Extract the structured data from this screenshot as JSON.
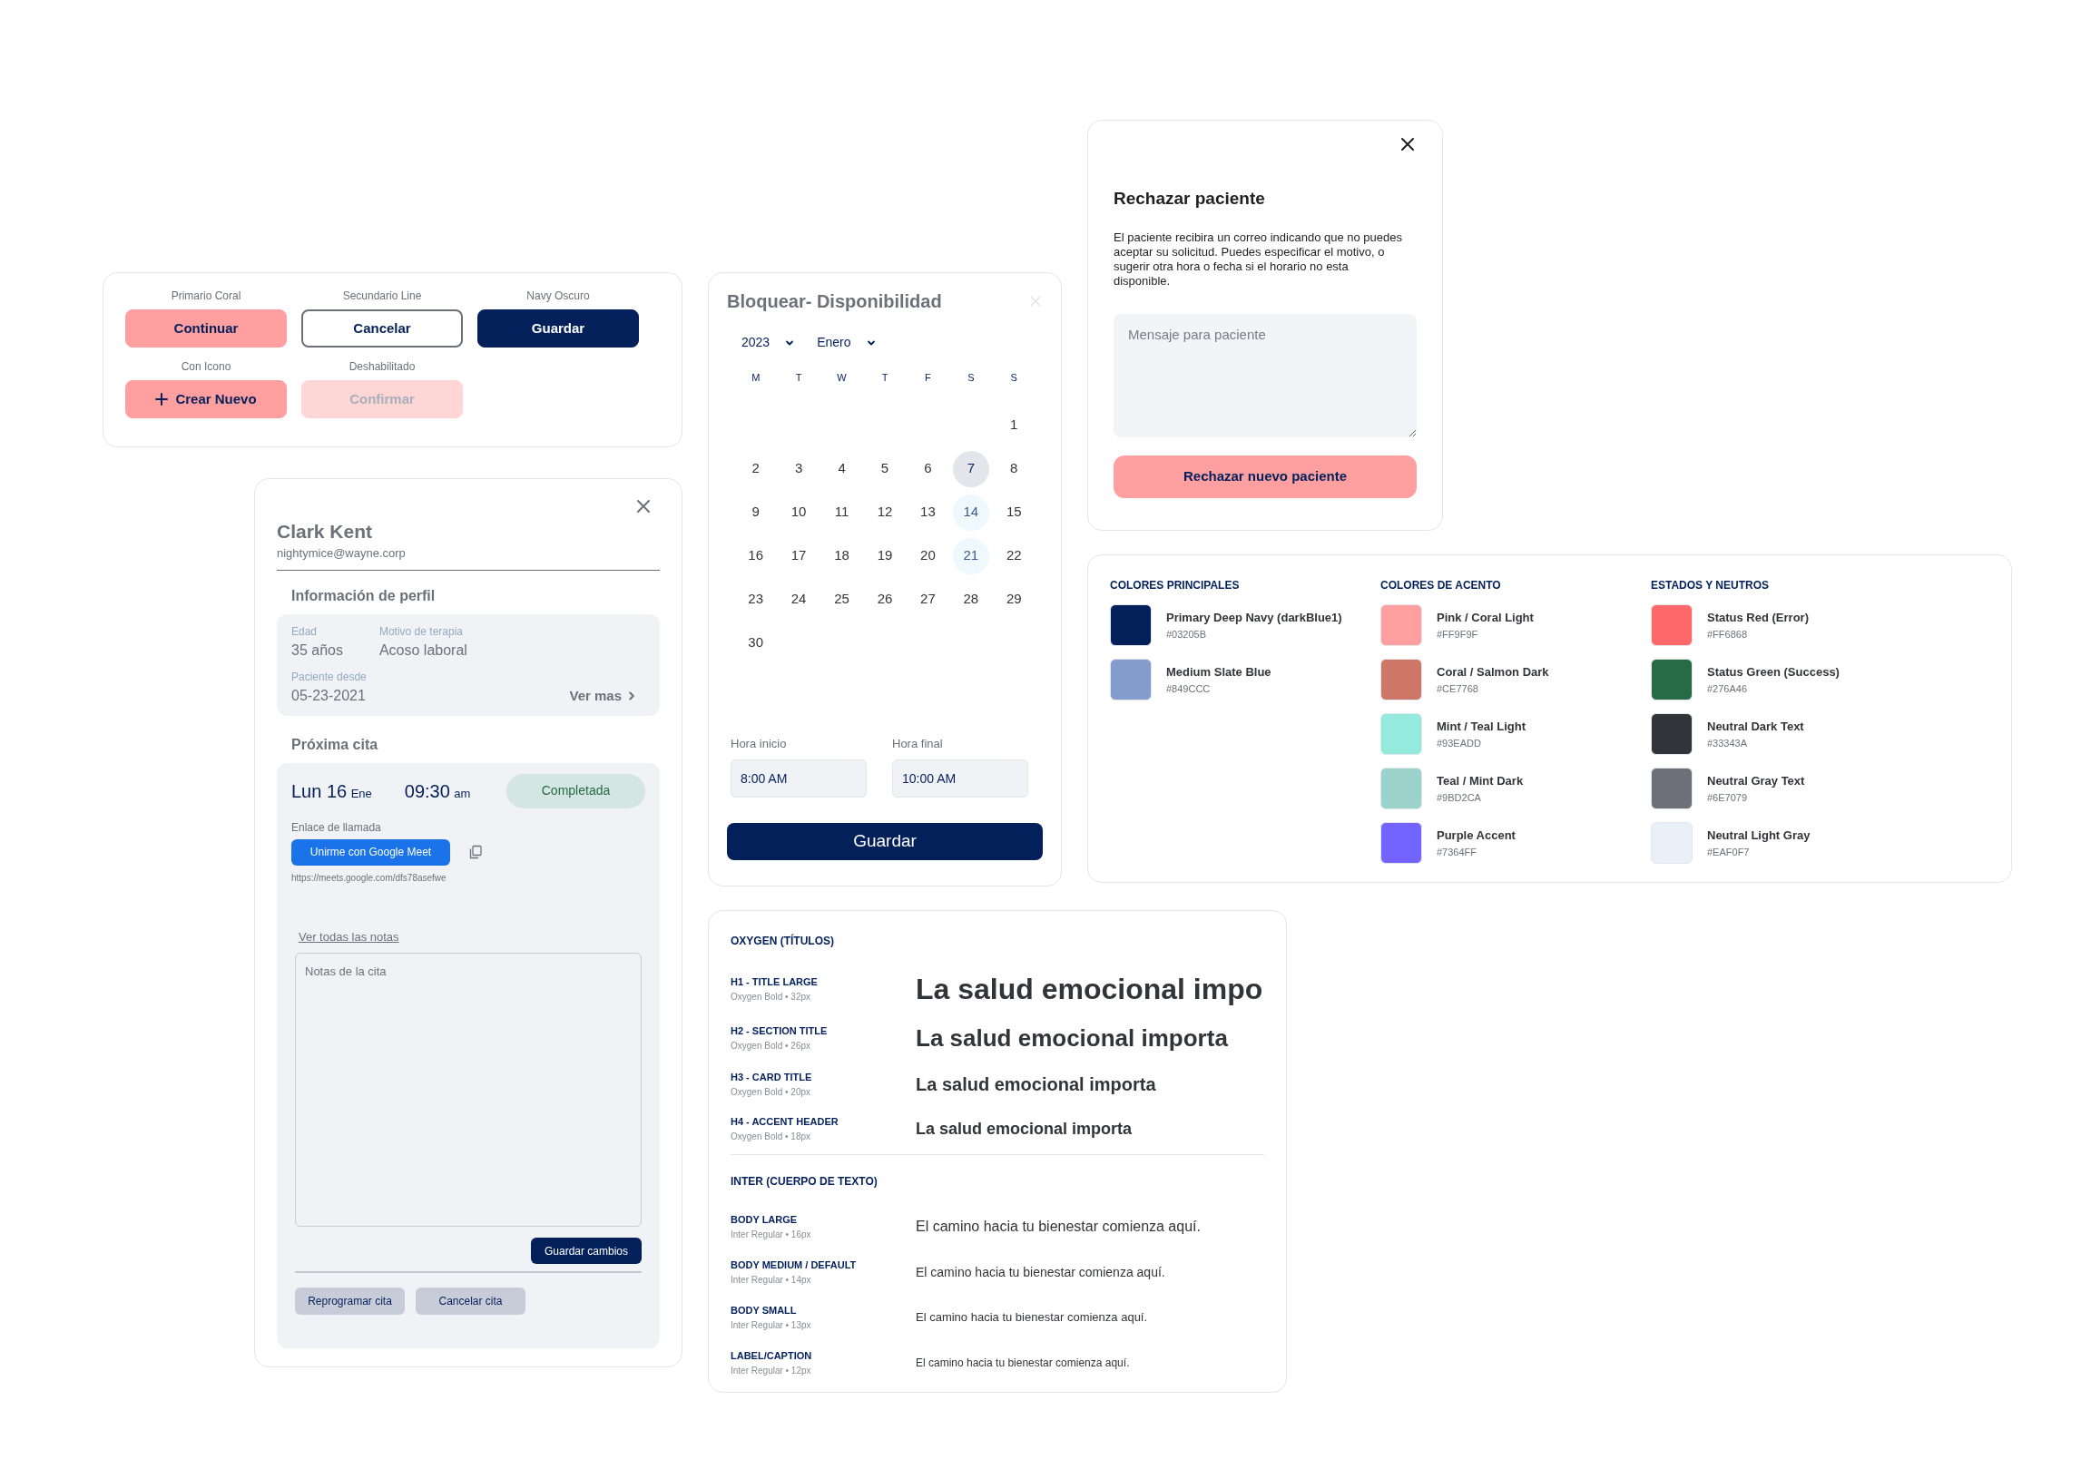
{
  "buttons_card": {
    "items": [
      {
        "caption": "Primario Coral",
        "label": "Continuar",
        "kind": "primary",
        "disabled": false,
        "has_icon": false
      },
      {
        "caption": "Secundario Line",
        "label": "Cancelar",
        "kind": "outline",
        "disabled": false,
        "has_icon": false
      },
      {
        "caption": "Navy Oscuro",
        "label": "Guardar",
        "kind": "navy",
        "disabled": false,
        "has_icon": false
      },
      {
        "caption": "Con Icono",
        "label": "Crear Nuevo",
        "kind": "primary",
        "disabled": false,
        "has_icon": true
      },
      {
        "caption": "Deshabilitado",
        "label": "Confirmar",
        "kind": "primary",
        "disabled": true,
        "has_icon": false
      }
    ]
  },
  "profile": {
    "name": "Clark Kent",
    "email": "nightymice@wayne.corp",
    "info_title": "Información de perfil",
    "fields": [
      {
        "label": "Edad",
        "value": "35 años"
      },
      {
        "label": "Motivo de terapia",
        "value": "Acoso laboral"
      }
    ],
    "since": {
      "label": "Paciente desde",
      "value": "05-23-2021"
    },
    "more_link": "Ver mas",
    "appointment_title": "Próxima cita",
    "appointment": {
      "day": "Lun 16",
      "month": "Ene",
      "time": "09:30",
      "period": "am",
      "status": "Completada",
      "call_label": "Enlace de llamada",
      "meet_button": "Unirme con Google Meet",
      "url": "https://meets.google.com/dfs78asefwe"
    },
    "notes_link": "Ver todas las notas",
    "notes_placeholder": "Notas de la cita",
    "save_button": "Guardar cambios",
    "actions": [
      "Reprogramar cita",
      "Cancelar cita"
    ]
  },
  "calendar": {
    "title": "Bloquear- Disponibilidad",
    "year": "2023",
    "month": "Enero",
    "weekdays": [
      "M",
      "T",
      "W",
      "T",
      "F",
      "S",
      "S"
    ],
    "weeks": [
      {
        "kind": "lead",
        "days": [
          {
            "label": "1",
            "selected": false,
            "marked": false
          }
        ]
      },
      {
        "kind": "full",
        "days": [
          {
            "label": "2",
            "selected": false,
            "marked": false
          },
          {
            "label": "3",
            "selected": false,
            "marked": false
          },
          {
            "label": "4",
            "selected": false,
            "marked": false
          },
          {
            "label": "5",
            "selected": false,
            "marked": false
          },
          {
            "label": "6",
            "selected": false,
            "marked": false
          },
          {
            "label": "7",
            "selected": true,
            "marked": false
          },
          {
            "label": "8",
            "selected": false,
            "marked": false
          }
        ]
      },
      {
        "kind": "full",
        "days": [
          {
            "label": "9",
            "selected": false,
            "marked": false
          },
          {
            "label": "10",
            "selected": false,
            "marked": false
          },
          {
            "label": "11",
            "selected": false,
            "marked": false
          },
          {
            "label": "12",
            "selected": false,
            "marked": false
          },
          {
            "label": "13",
            "selected": false,
            "marked": false
          },
          {
            "label": "14",
            "selected": false,
            "marked": true
          },
          {
            "label": "15",
            "selected": false,
            "marked": false
          }
        ]
      },
      {
        "kind": "full",
        "days": [
          {
            "label": "16",
            "selected": false,
            "marked": false
          },
          {
            "label": "17",
            "selected": false,
            "marked": false
          },
          {
            "label": "18",
            "selected": false,
            "marked": false
          },
          {
            "label": "19",
            "selected": false,
            "marked": false
          },
          {
            "label": "20",
            "selected": false,
            "marked": false
          },
          {
            "label": "21",
            "selected": false,
            "marked": true
          },
          {
            "label": "22",
            "selected": false,
            "marked": false
          }
        ]
      },
      {
        "kind": "full",
        "days": [
          {
            "label": "23",
            "selected": false,
            "marked": false
          },
          {
            "label": "24",
            "selected": false,
            "marked": false
          },
          {
            "label": "25",
            "selected": false,
            "marked": false
          },
          {
            "label": "26",
            "selected": false,
            "marked": false
          },
          {
            "label": "27",
            "selected": false,
            "marked": false
          },
          {
            "label": "28",
            "selected": false,
            "marked": false
          },
          {
            "label": "29",
            "selected": false,
            "marked": false
          }
        ]
      },
      {
        "kind": "tail",
        "days": [
          {
            "label": "30",
            "selected": false,
            "marked": false
          }
        ]
      }
    ],
    "start_label": "Hora inicio",
    "start_value": "8:00 AM",
    "end_label": "Hora final",
    "end_value": "10:00 AM",
    "save_button": "Guardar"
  },
  "reject_modal": {
    "title": "Rechazar paciente",
    "message": "El paciente recibira un correo indicando que no puedes aceptar su solicitud. Puedes especificar el motivo, o sugerir otra hora o fecha si el horario no esta disponible.",
    "placeholder": "Mensaje para paciente",
    "button": "Rechazar nuevo paciente"
  },
  "palette": {
    "groups": [
      {
        "title": "COLORES PRINCIPALES",
        "swatches": [
          {
            "name": "Primary Deep Navy (darkBlue1)",
            "hex": "#03205B",
            "color": "#03205b"
          },
          {
            "name": "Medium Slate Blue",
            "hex": "#849CCC",
            "color": "#849ccc"
          }
        ]
      },
      {
        "title": "COLORES DE ACENTO",
        "swatches": [
          {
            "name": "Pink / Coral Light",
            "hex": "#FF9F9F",
            "color": "#ff9f9f"
          },
          {
            "name": "Coral / Salmon Dark",
            "hex": "#CE7768",
            "color": "#ce7768"
          },
          {
            "name": "Mint / Teal Light",
            "hex": "#93EADD",
            "color": "#93eadd"
          },
          {
            "name": "Teal / Mint Dark",
            "hex": "#9BD2CA",
            "color": "#9bd2ca"
          },
          {
            "name": "Purple Accent",
            "hex": "#7364FF",
            "color": "#7364ff"
          }
        ]
      },
      {
        "title": "ESTADOS Y NEUTROS",
        "swatches": [
          {
            "name": "Status Red (Error)",
            "hex": "#FF6868",
            "color": "#ff6868"
          },
          {
            "name": "Status Green (Success)",
            "hex": "#276A46",
            "color": "#276a46"
          },
          {
            "name": "Neutral Dark Text",
            "hex": "#33343A",
            "color": "#33343a"
          },
          {
            "name": "Neutral Gray Text",
            "hex": "#6E7079",
            "color": "#6e7079"
          },
          {
            "name": "Neutral Light Gray",
            "hex": "#EAF0F7",
            "color": "#eaf0f7"
          }
        ]
      }
    ]
  },
  "typography": {
    "sections": [
      {
        "title": "OXYGEN (TÍTULOS)",
        "rows": [
          {
            "kind": "h1",
            "name": "H1 - TITLE LARGE",
            "spec": "Oxygen Bold • 32px",
            "sample": "La salud emocional impo"
          },
          {
            "kind": "h2",
            "name": "H2 - SECTION TITLE",
            "spec": "Oxygen Bold • 26px",
            "sample": "La salud emocional importa"
          },
          {
            "kind": "h3",
            "name": "H3 - CARD TITLE",
            "spec": "Oxygen Bold • 20px",
            "sample": "La salud emocional importa"
          },
          {
            "kind": "h4",
            "name": "H4 - ACCENT HEADER",
            "spec": "Oxygen Bold • 18px",
            "sample": "La salud emocional importa"
          }
        ]
      },
      {
        "title": "INTER (CUERPO DE TEXTO)",
        "rows": [
          {
            "kind": "body_large",
            "name": "BODY LARGE",
            "spec": "Inter Regular • 16px",
            "sample": "El camino hacia tu bienestar comienza aquí."
          },
          {
            "kind": "body_medium",
            "name": "BODY MEDIUM / DEFAULT",
            "spec": "Inter Regular • 14px",
            "sample": "El camino hacia tu bienestar comienza aquí."
          },
          {
            "kind": "body_small",
            "name": "BODY SMALL",
            "spec": "Inter Regular • 13px",
            "sample": "El camino hacia tu bienestar comienza aquí."
          },
          {
            "kind": "caption",
            "name": "LABEL/CAPTION",
            "spec": "Inter Regular • 12px",
            "sample": "El camino hacia tu bienestar comienza aquí."
          }
        ]
      }
    ]
  }
}
